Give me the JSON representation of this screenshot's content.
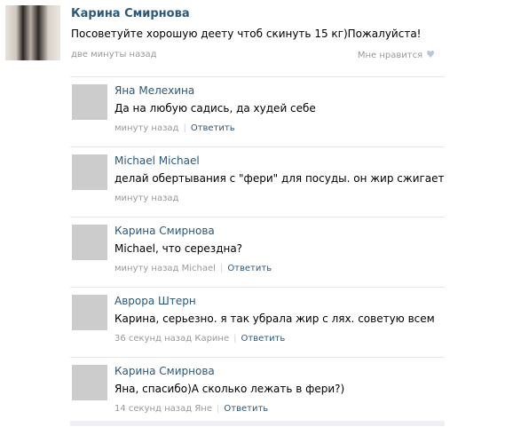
{
  "post": {
    "author": "Карина Смирнова",
    "text": "Посоветуйте хорошую деету чтоб скинуть 15 кг)Пожалуйста!",
    "time": "две минуты назад",
    "like_label": "Мне нравится",
    "like_icon": "heart-icon"
  },
  "comments": [
    {
      "author": "Яна Мелехина",
      "text": "Да на любую садись, да худей себе",
      "time": "минуту назад",
      "reply_label": "Ответить"
    },
    {
      "author": "Michael Michael",
      "text": "делай обертывания с \"фери\" для посуды. он жир сжигает",
      "time": "минуту назад",
      "reply_label": ""
    },
    {
      "author": "Карина Смирнова",
      "text": "Michael, что серездна?",
      "time": "минуту назад Michael",
      "reply_label": "Ответить"
    },
    {
      "author": "Аврора Штерн",
      "text": "Карина, серьезно. я так убрала жир с лях. советую всем",
      "time": "36 секунд назад Карине",
      "reply_label": "Ответить"
    },
    {
      "author": "Карина Смирнова",
      "text": "Яна, спасибо)А сколько лежать в фери?)",
      "time": "14 секунд назад Яне",
      "reply_label": "Ответить"
    }
  ],
  "colors": {
    "link": "#2b587a",
    "meta": "#999999",
    "divider": "#e6e8ec"
  }
}
